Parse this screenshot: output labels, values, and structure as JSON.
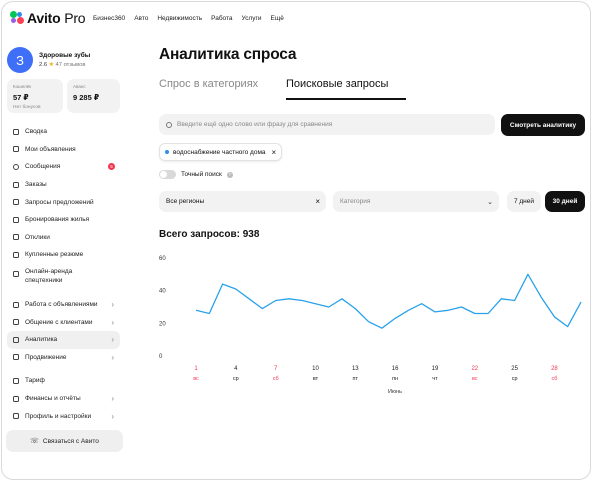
{
  "header": {
    "logo_text": "Avito",
    "logo_suffix": "Pro",
    "nav": [
      "Бизнес360",
      "Авто",
      "Недвижимость",
      "Работа",
      "Услуги",
      "Ещё"
    ]
  },
  "profile": {
    "avatar_letter": "З",
    "name": "Здоровые зубы",
    "rating": "2.6",
    "star": "★",
    "reviews": "47 отзывов"
  },
  "wallet": {
    "label": "Кошелёк",
    "value": "57 ₽",
    "sub": "Нет бонусов"
  },
  "balance": {
    "label": "Аванс",
    "value": "9 285 ₽"
  },
  "menu": [
    {
      "label": "Сводка",
      "icon": "summary-icon"
    },
    {
      "label": "Мои объявления",
      "icon": "listings-icon"
    },
    {
      "label": "Сообщения",
      "icon": "messages-icon",
      "badge": "5"
    },
    {
      "label": "Заказы",
      "icon": "orders-icon"
    },
    {
      "label": "Запросы предложений",
      "icon": "requests-icon"
    },
    {
      "label": "Бронирования жилья",
      "icon": "booking-icon"
    },
    {
      "label": "Отклики",
      "icon": "responses-icon"
    },
    {
      "label": "Купленные резюме",
      "icon": "resume-icon"
    },
    {
      "label": "Онлайн-аренда спецтехники",
      "icon": "rental-icon"
    },
    {
      "label": "Работа с объявлениями",
      "icon": "work-listings-icon"
    },
    {
      "label": "Общение с клиентами",
      "icon": "clients-icon"
    },
    {
      "label": "Аналитика",
      "icon": "analytics-icon"
    },
    {
      "label": "Продвижение",
      "icon": "promotion-icon"
    },
    {
      "label": "Тариф",
      "icon": "tariff-icon"
    },
    {
      "label": "Финансы и отчёты",
      "icon": "finance-icon"
    },
    {
      "label": "Профиль и настройки",
      "icon": "settings-icon"
    }
  ],
  "contact_button": "Связаться с Авито",
  "page": {
    "title": "Аналитика спроса",
    "tabs": [
      "Спрос в категориях",
      "Поисковые запросы"
    ],
    "active_tab": "Поисковые запросы",
    "search_placeholder": "Введите ещё одно слово или фразу для сравнения",
    "search_button": "Смотреть аналитику",
    "chip": "водоснабжение частного дома",
    "exact_search": "Точный поиск",
    "region": "Все регионы",
    "category_placeholder": "Категория",
    "period_7": "7 дней",
    "period_30": "30 дней",
    "total": "Всего запросов: 938"
  },
  "colors": {
    "line": "#2aa2ea",
    "weekend": "#f2364e",
    "accent": "#111111"
  },
  "chart_data": {
    "type": "line",
    "y_ticks": [
      "60",
      "40",
      "20",
      "0"
    ],
    "ylim": [
      0,
      60
    ],
    "x": [
      1,
      2,
      3,
      4,
      5,
      6,
      7,
      8,
      9,
      10,
      11,
      12,
      13,
      14,
      15,
      16,
      17,
      18,
      19,
      20,
      21,
      22,
      23,
      24,
      25,
      26,
      27,
      28,
      29,
      30
    ],
    "values": [
      28,
      26,
      44,
      41,
      35,
      29,
      34,
      35,
      34,
      32,
      30,
      35,
      29,
      21,
      17,
      23,
      28,
      32,
      27,
      28,
      30,
      26,
      26,
      35,
      34,
      50,
      36,
      24,
      18,
      33
    ],
    "x_ticks": [
      {
        "day": "1",
        "wd": "вс",
        "weekend": true
      },
      {
        "day": "4",
        "wd": "ср",
        "weekend": false
      },
      {
        "day": "7",
        "wd": "сб",
        "weekend": true
      },
      {
        "day": "10",
        "wd": "вт",
        "weekend": false
      },
      {
        "day": "13",
        "wd": "пт",
        "weekend": false
      },
      {
        "day": "16",
        "wd": "пн",
        "weekend": false
      },
      {
        "day": "19",
        "wd": "чт",
        "weekend": false
      },
      {
        "day": "22",
        "wd": "вс",
        "weekend": true
      },
      {
        "day": "25",
        "wd": "ср",
        "weekend": false
      },
      {
        "day": "28",
        "wd": "сб",
        "weekend": true
      }
    ],
    "xlabel": "Июнь",
    "grid": false
  }
}
